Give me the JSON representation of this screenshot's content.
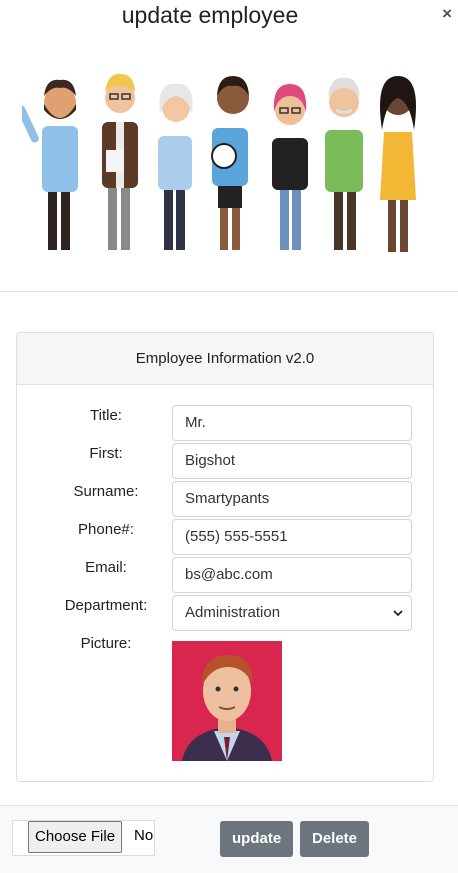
{
  "dialog": {
    "title": "update employee",
    "close_label": "×"
  },
  "card": {
    "header": "Employee Information v2.0"
  },
  "form": {
    "title_label": "Title:",
    "title_value": "Mr.",
    "first_label": "First:",
    "first_value": "Bigshot",
    "surname_label": "Surname:",
    "surname_value": "Smartypants",
    "phone_label": "Phone#:",
    "phone_value": "(555) 555-5551",
    "email_label": "Email:",
    "email_value": "bs@abc.com",
    "department_label": "Department:",
    "department_value": "Administration",
    "picture_label": "Picture:"
  },
  "footer": {
    "choose_file_label": "Choose File",
    "file_status": "No file chosen",
    "update_label": "update",
    "delete_label": "Delete"
  },
  "colors": {
    "button_gray": "#6c757d",
    "header_bg": "#f6f6f6",
    "portrait_bg": "#d9264f"
  }
}
